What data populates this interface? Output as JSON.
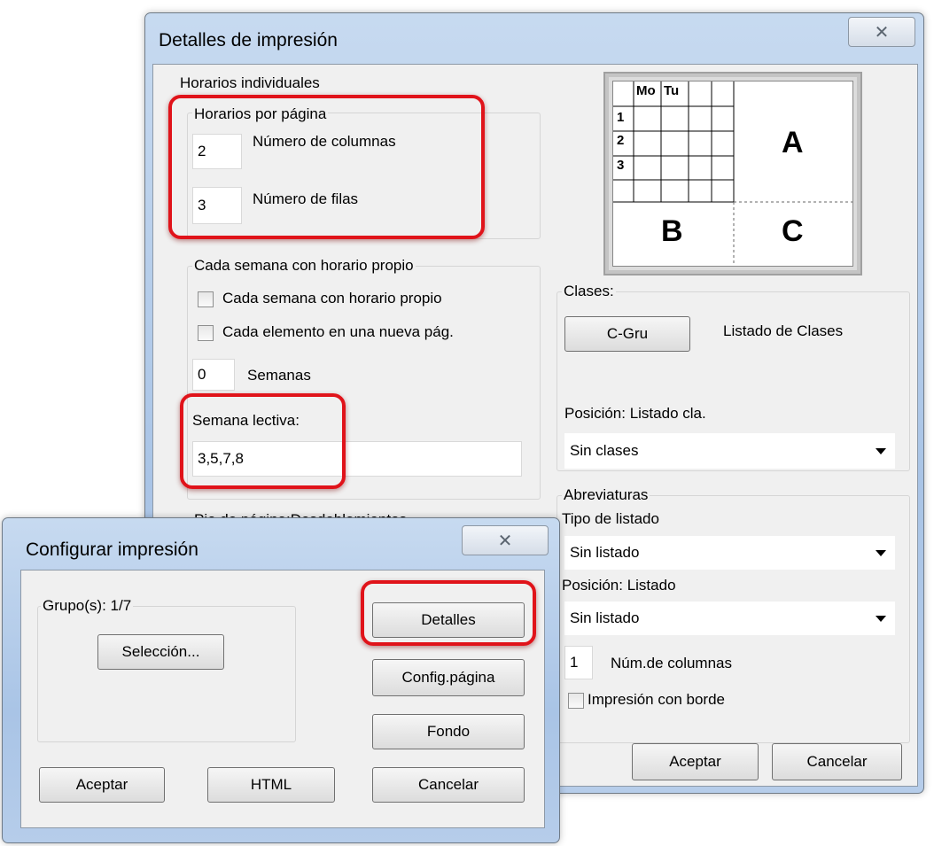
{
  "details_dialog": {
    "title": "Detalles de impresión",
    "close_glyph": "✕",
    "individual_label": "Horarios individuales",
    "per_page": {
      "label": "Horarios por página",
      "columns_value": "2",
      "columns_label": "Número de columnas",
      "rows_value": "3",
      "rows_label": "Número de filas"
    },
    "week": {
      "label": "Cada semana con horario propio",
      "cb_week": "Cada semana con horario propio",
      "cb_element": "Cada elemento en una nueva pág.",
      "weeks_value": "0",
      "weeks_label": "Semanas",
      "lective_label": "Semana lectiva:",
      "lective_value": "3,5,7,8"
    },
    "footer_label": "Pie de página:Desdoblamientos",
    "preview": {
      "col_mo": "Mo",
      "col_tu": "Tu",
      "row1": "1",
      "row2": "2",
      "row3": "3",
      "a": "A",
      "b": "B",
      "c": "C"
    },
    "clases": {
      "label": "Clases:",
      "button": "C-Gru",
      "listing_text": "Listado de Clases",
      "position_label": "Posición: Listado cla.",
      "position_value": "Sin clases"
    },
    "abbrev": {
      "label": "Abreviaturas",
      "type_label": "Tipo de listado",
      "type_value": "Sin listado",
      "position_label": "Posición: Listado",
      "position_value": "Sin listado",
      "columns_value": "1",
      "columns_label": "Núm.de columnas",
      "border_label": "Impresión con borde"
    },
    "ok_button": "Aceptar",
    "cancel_button": "Cancelar"
  },
  "print_dialog": {
    "title": "Configurar impresión",
    "close_glyph": "✕",
    "group_label": "Grupo(s): 1/7",
    "selection_button": "Selección...",
    "details_button": "Detalles",
    "page_setup_button": "Config.página",
    "background_button": "Fondo",
    "ok_button": "Aceptar",
    "html_button": "HTML",
    "cancel_button": "Cancelar"
  },
  "colors": {
    "highlight": "#e0131a",
    "window_frame": "#b6cdea",
    "client_bg": "#f0f0f0"
  }
}
